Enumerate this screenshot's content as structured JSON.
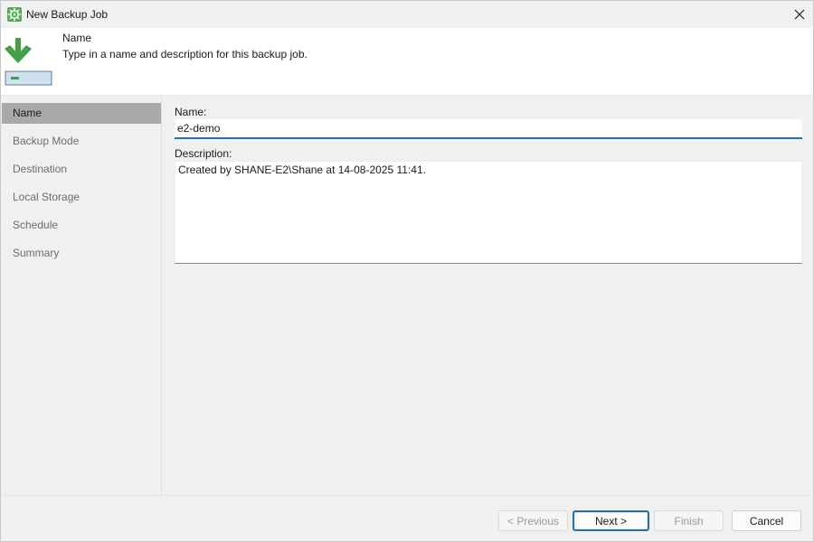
{
  "window": {
    "title": "New Backup Job",
    "accent_color": "#2b6fa8",
    "app_icon": "gear-icon"
  },
  "header": {
    "title": "Name",
    "description": "Type in a name and description for this backup job.",
    "icon": "download-arrow-icon"
  },
  "steps": [
    {
      "label": "Name",
      "active": true
    },
    {
      "label": "Backup Mode",
      "active": false
    },
    {
      "label": "Destination",
      "active": false
    },
    {
      "label": "Local Storage",
      "active": false
    },
    {
      "label": "Schedule",
      "active": false
    },
    {
      "label": "Summary",
      "active": false
    }
  ],
  "form": {
    "name_label": "Name:",
    "name_value": "e2-demo",
    "description_label": "Description:",
    "description_value": "Created by SHANE-E2\\Shane at 14-08-2025 11:41."
  },
  "footer": {
    "previous_label": "< Previous",
    "next_label": "Next >",
    "finish_label": "Finish",
    "cancel_label": "Cancel"
  }
}
